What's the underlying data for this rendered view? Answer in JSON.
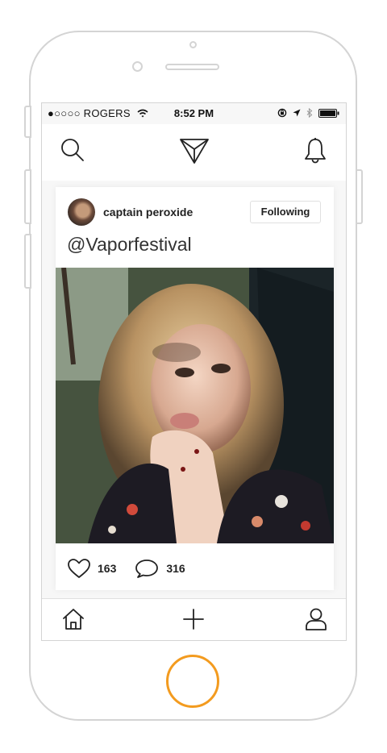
{
  "status_bar": {
    "carrier": "●○○○○ ROGERS",
    "time": "8:52 PM"
  },
  "nav": {
    "icons": [
      "search-icon",
      "send-icon",
      "bell-icon"
    ]
  },
  "post": {
    "username": "captain peroxide",
    "follow_label": "Following",
    "caption": "@Vaporfestival",
    "likes": "163",
    "comments": "316"
  },
  "tab_bar": {
    "icons": [
      "home-icon",
      "plus-icon",
      "profile-icon"
    ]
  },
  "colors": {
    "home_button": "#f39b1f",
    "phone_outline": "#d4d4d4"
  }
}
